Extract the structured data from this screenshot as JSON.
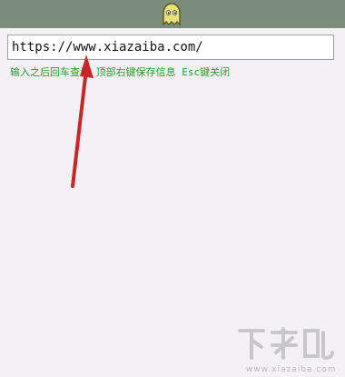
{
  "url_input": {
    "value": "https://www.xiazaiba.com/"
  },
  "hint_text": "输入之后回车查询 顶部右键保存信息 Esc键关闭",
  "app_icon": "ghost-icon",
  "watermark": {
    "logo": "下载吧",
    "url": "www.xiazaiba.com"
  },
  "colors": {
    "topbar": "#7c8c7a",
    "hint": "#2a9a2a",
    "arrow": "#c62828"
  }
}
